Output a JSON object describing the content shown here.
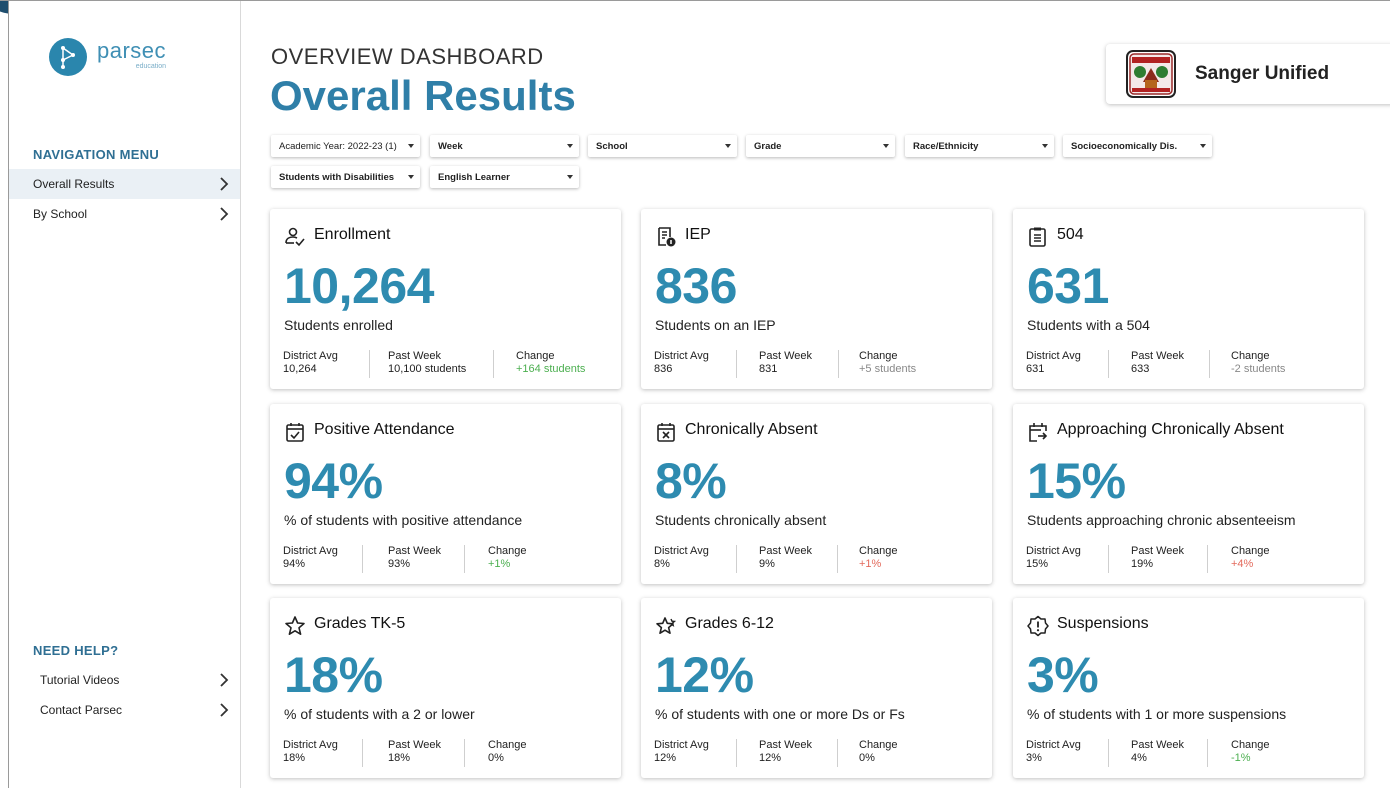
{
  "sidebar": {
    "logo": {
      "name": "parsec",
      "sub": "education"
    },
    "nav_heading": "NAVIGATION MENU",
    "nav_items": [
      {
        "label": "Overall Results",
        "active": true
      },
      {
        "label": "By School",
        "active": false
      }
    ],
    "help_heading": "NEED HELP?",
    "help_items": [
      {
        "label": "Tutorial Videos"
      },
      {
        "label": "Contact Parsec"
      }
    ]
  },
  "header": {
    "kicker": "OVERVIEW DASHBOARD",
    "title": "Overall Results",
    "district": "Sanger Unified"
  },
  "filters": [
    "Academic Year: 2022-23 (1)",
    "Week",
    "School",
    "Grade",
    "Race/Ethnicity",
    "Socioeconomically Dis.",
    "Students with Disabilities",
    "English Learner"
  ],
  "stat_labels": {
    "district": "District Avg",
    "past": "Past Week",
    "change": "Change"
  },
  "cards": [
    {
      "icon": "person-check-icon",
      "title": "Enrollment",
      "value": "10,264",
      "desc": "Students enrolled",
      "district": "10,264",
      "past": "10,100 students",
      "change": "+164 students",
      "change_tone": "green"
    },
    {
      "icon": "iep-document-icon",
      "title": "IEP",
      "value": "836",
      "desc": "Students on an IEP",
      "district": "836",
      "past": "831",
      "change": "+5 students",
      "change_tone": "grey"
    },
    {
      "icon": "clipboard-list-icon",
      "title": "504",
      "value": "631",
      "desc": "Students with a 504",
      "district": "631",
      "past": "633",
      "change": "-2 students",
      "change_tone": "grey"
    },
    {
      "icon": "calendar-check-icon",
      "title": "Positive Attendance",
      "value": "94%",
      "desc": "% of students with positive attendance",
      "district": "94%",
      "past": "93%",
      "change": "+1%",
      "change_tone": "green"
    },
    {
      "icon": "calendar-x-icon",
      "title": "Chronically Absent",
      "value": "8%",
      "desc": "Students chronically absent",
      "district": "8%",
      "past": "9%",
      "change": "+1%",
      "change_tone": "red"
    },
    {
      "icon": "calendar-arrow-icon",
      "title": "Approaching Chronically Absent",
      "value": "15%",
      "desc": "Students approaching chronic absenteeism",
      "district": "15%",
      "past": "19%",
      "change": "+4%",
      "change_tone": "red"
    },
    {
      "icon": "star-icon",
      "title": "Grades TK-5",
      "value": "18%",
      "desc": "% of students with a 2 or lower",
      "district": "18%",
      "past": "18%",
      "change": "0%",
      "change_tone": "plain"
    },
    {
      "icon": "stars-icon",
      "title": "Grades 6-12",
      "value": "12%",
      "desc": "% of students with one or more Ds or Fs",
      "district": "12%",
      "past": "12%",
      "change": "0%",
      "change_tone": "plain"
    },
    {
      "icon": "alert-badge-icon",
      "title": "Suspensions",
      "value": "3%",
      "desc": "% of students with 1 or more suspensions",
      "district": "3%",
      "past": "4%",
      "change": "-1%",
      "change_tone": "green"
    }
  ]
}
